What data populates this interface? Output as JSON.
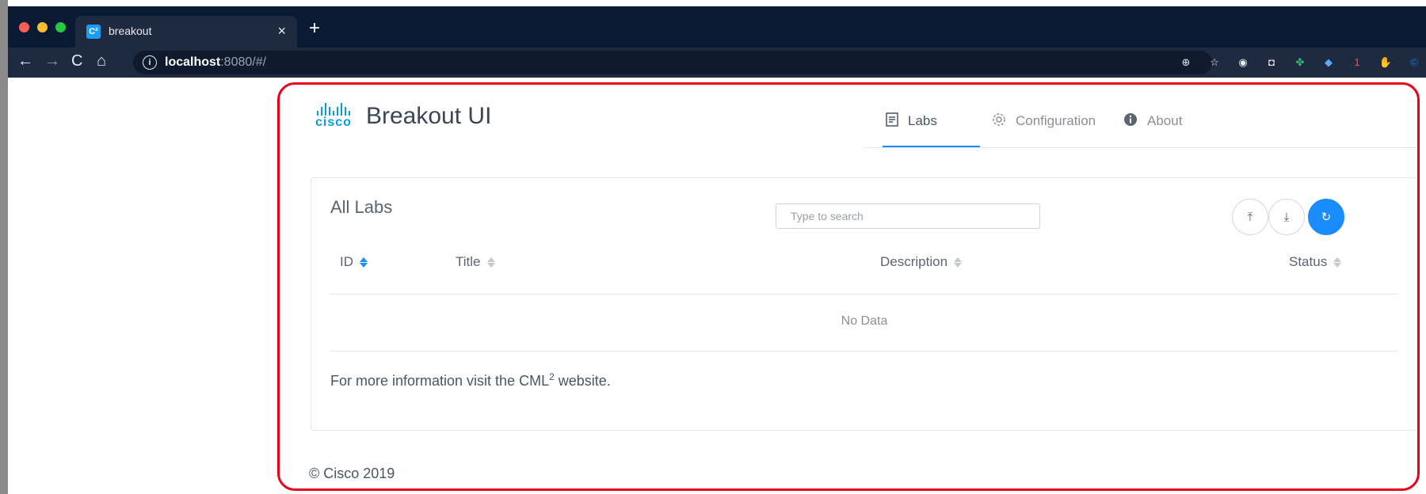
{
  "browser": {
    "tab": {
      "favicon": "C²",
      "title": "breakout",
      "close": "×"
    },
    "new_tab": "+",
    "url": {
      "host": "localhost",
      "rest": ":8080/#/"
    },
    "nav": {
      "back": "←",
      "forward": "→",
      "reload": "C",
      "home": "⌂"
    },
    "extensions": [
      {
        "name": "zoom-icon",
        "glyph": "⊕",
        "color": "#e8eaed"
      },
      {
        "name": "star-icon",
        "glyph": "☆",
        "color": "#e8eaed"
      },
      {
        "name": "record-icon",
        "glyph": "◉",
        "color": "#e8eaed"
      },
      {
        "name": "camera-icon",
        "glyph": "◘",
        "color": "#e8eaed"
      },
      {
        "name": "clover-icon",
        "glyph": "✤",
        "color": "#3cb371"
      },
      {
        "name": "diamond-icon",
        "glyph": "◆",
        "color": "#5aa9ff"
      },
      {
        "name": "badge-count",
        "glyph": "1",
        "color": "#ff4d3a"
      },
      {
        "name": "hand-icon",
        "glyph": "✋",
        "color": "#e8213a"
      },
      {
        "name": "c-icon",
        "glyph": "©",
        "color": "#1a73e8"
      }
    ]
  },
  "header": {
    "logo_text": "cisco",
    "app_title": "Breakout UI",
    "nav": [
      {
        "label": "Labs",
        "icon": "document-icon",
        "active": true
      },
      {
        "label": "Configuration",
        "icon": "gear-icon",
        "active": false
      },
      {
        "label": "About",
        "icon": "info-icon",
        "active": false
      }
    ]
  },
  "labs": {
    "title": "All Labs",
    "search_placeholder": "Type to search",
    "columns": [
      {
        "label": "ID",
        "active": true
      },
      {
        "label": "Title",
        "active": false
      },
      {
        "label": "Description",
        "active": false
      },
      {
        "label": "Status",
        "active": false
      }
    ],
    "no_data": "No Data",
    "info_prefix": "For more information visit the CML",
    "info_sup": "2",
    "info_suffix": " website.",
    "buttons": {
      "upload": "⤒",
      "download": "⤓",
      "refresh": "↻"
    }
  },
  "footer": {
    "copyright": "© Cisco 2019"
  },
  "colors": {
    "accent": "#1a8cff",
    "cisco_blue": "#049fd9",
    "highlight": "#e8001c",
    "chrome": "#0b1a33"
  }
}
